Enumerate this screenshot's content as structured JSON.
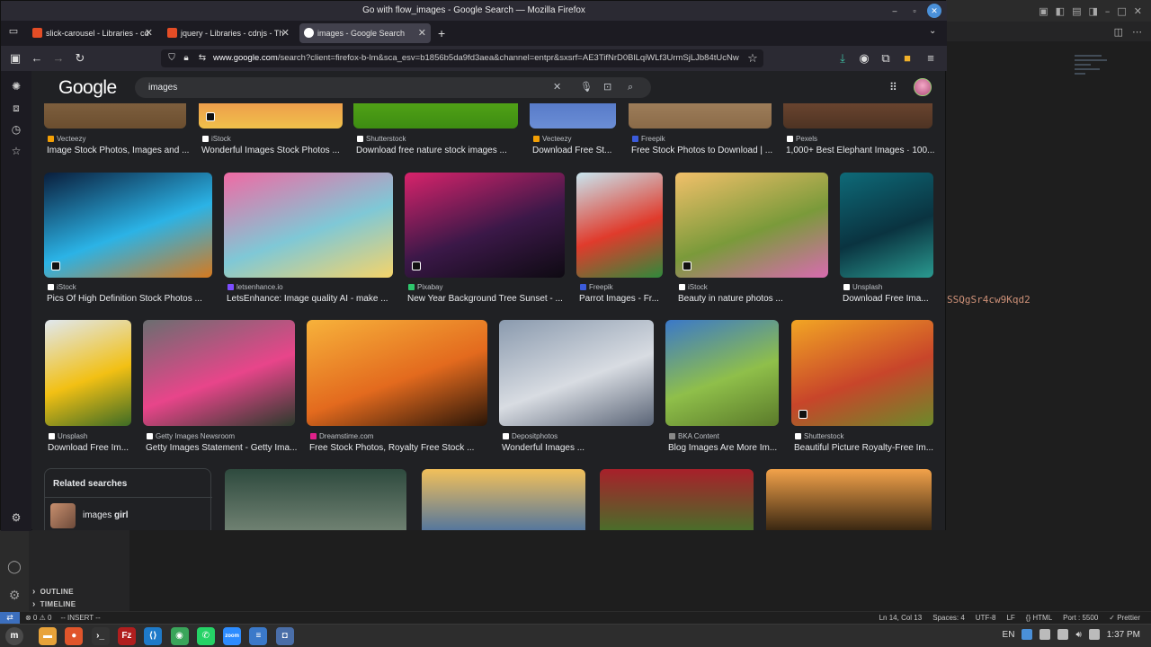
{
  "firefox": {
    "window_title": "Go with flow_images - Google Search — Mozilla Firefox",
    "tabs": [
      {
        "label": "slick-carousel - Libraries - cd",
        "fav_color": "#e44d26"
      },
      {
        "label": "jquery - Libraries - cdnjs - Th",
        "fav_color": "#e44d26"
      },
      {
        "label": "images - Google Search",
        "fav_color": "#ffffff"
      }
    ],
    "url_host": "www.google.com",
    "url_rest": "/search?client=firefox-b-lm&sca_esv=b1856b5da9fd3aea&channel=entpr&sxsrf=AE3TifNrD0BlLqiWLf3UrmSjLJb84tUcNw"
  },
  "google": {
    "logo": "Google",
    "query": "images",
    "results_row1": [
      {
        "source": "Vecteezy",
        "title": "Image Stock Photos, Images and ...",
        "fav": "#f29f05",
        "colors": [
          "#a88560",
          "#6b4e2f"
        ]
      },
      {
        "source": "iStock",
        "title": "Wonderful Images Stock Photos ...",
        "fav": "#ffffff",
        "colors": [
          "#e94b4b",
          "#f0c14b"
        ]
      },
      {
        "source": "Shutterstock",
        "title": "Download free nature stock images ...",
        "fav": "#ffffff",
        "colors": [
          "#7ed321",
          "#3d8c12"
        ]
      },
      {
        "source": "Vecteezy",
        "title": "Download Free St...",
        "fav": "#f29f05",
        "colors": [
          "#2b4ea8",
          "#6b8ed6"
        ]
      },
      {
        "source": "Freepik",
        "title": "Free Stock Photos to Download | ...",
        "fav": "#3b5bdb",
        "colors": [
          "#c9a982",
          "#8a6a48"
        ]
      },
      {
        "source": "Pexels",
        "title": "1,000+ Best Elephant Images · 100...",
        "fav": "#ffffff",
        "colors": [
          "#a86b4a",
          "#4e3323"
        ]
      }
    ],
    "results_row2": [
      {
        "source": "iStock",
        "title": "Pics Of High Definition Stock Photos ...",
        "fav": "#ffffff",
        "colors": [
          "#0a1e3c",
          "#2bb3e6",
          "#d67a1f"
        ]
      },
      {
        "source": "letsenhance.io",
        "title": "LetsEnhance: Image quality AI - make ...",
        "fav": "#7c4dff",
        "colors": [
          "#f06aa4",
          "#7fc8d6",
          "#f5d46a"
        ]
      },
      {
        "source": "Pixabay",
        "title": "New Year Background Tree Sunset - ...",
        "fav": "#2ec66d",
        "colors": [
          "#d8236b",
          "#3b1848",
          "#0e0a12"
        ]
      },
      {
        "source": "Freepik",
        "title": "Parrot Images - Fr...",
        "fav": "#3b5bdb",
        "colors": [
          "#c8e6f0",
          "#e03b2c",
          "#2f8a3b"
        ]
      },
      {
        "source": "iStock",
        "title": "Beauty in nature photos ...",
        "fav": "#ffffff",
        "colors": [
          "#f2c06a",
          "#7a9a3a",
          "#d86bb0"
        ]
      },
      {
        "source": "Unsplash",
        "title": "Download Free Ima...",
        "fav": "#ffffff",
        "colors": [
          "#0e6a78",
          "#0a3340",
          "#2a9a90"
        ]
      }
    ],
    "results_row3": [
      {
        "source": "Unsplash",
        "title": "Download Free Im...",
        "fav": "#ffffff",
        "colors": [
          "#e0e8f0",
          "#f2c014",
          "#3d6b25"
        ]
      },
      {
        "source": "Getty Images Newsroom",
        "title": "Getty Images Statement - Getty Ima...",
        "fav": "#ffffff",
        "colors": [
          "#6a6e70",
          "#e8458a",
          "#2b3a2c"
        ]
      },
      {
        "source": "Dreamstime.com",
        "title": "Free Stock Photos, Royalty Free Stock ...",
        "fav": "#e0218a",
        "colors": [
          "#f7b23b",
          "#e36a1e",
          "#2a1608"
        ]
      },
      {
        "source": "Depositphotos",
        "title": "Wonderful Images ...",
        "fav": "#ffffff",
        "colors": [
          "#8a9aae",
          "#d8dce2",
          "#5a6476"
        ]
      },
      {
        "source": "BKA Content",
        "title": "Blog Images Are More Im...",
        "fav": "#888888",
        "colors": [
          "#3a78c9",
          "#8fbf4a",
          "#5a7a2a"
        ]
      },
      {
        "source": "Shutterstock",
        "title": "Beautiful Picture Royalty-Free Im...",
        "fav": "#ffffff",
        "colors": [
          "#f2a524",
          "#c8452a",
          "#6b8a2a"
        ]
      }
    ],
    "results_row4_colors": [
      [
        "#2e4a3e",
        "#7a8a7a"
      ],
      [
        "#f2c05a",
        "#3a6aa8"
      ],
      [
        "#a8202a",
        "#3a7a2a"
      ],
      [
        "#f2a24a",
        "#1a1208"
      ]
    ],
    "related": {
      "heading": "Related searches",
      "item_prefix": "images",
      "item_bold": "girl"
    }
  },
  "vscode": {
    "code_fragment": "SSQgSr4cw9Kqd2",
    "outline": "OUTLINE",
    "timeline": "TIMELINE",
    "status_left": [
      "⊗ 0 ⚠ 0",
      "-- INSERT --"
    ],
    "status_right": [
      "Ln 14, Col 13",
      "Spaces: 4",
      "UTF-8",
      "LF",
      "{} HTML",
      "Port : 5500",
      "✓ Prettier"
    ]
  },
  "taskbar": {
    "apps": [
      {
        "name": "files",
        "color": "#e8a33a",
        "glyph": "▬"
      },
      {
        "name": "firefox",
        "color": "#e0552b",
        "glyph": "●"
      },
      {
        "name": "terminal",
        "color": "#333333",
        "glyph": "›_"
      },
      {
        "name": "filezilla",
        "color": "#b01e1e",
        "glyph": "Fz"
      },
      {
        "name": "vscode",
        "color": "#1e7ac9",
        "glyph": "⟨⟩"
      },
      {
        "name": "chrome",
        "color": "#3aa55a",
        "glyph": "◉"
      },
      {
        "name": "whatsapp",
        "color": "#25d366",
        "glyph": "✆"
      },
      {
        "name": "zoom",
        "color": "#2d8cff",
        "glyph": "zoom"
      },
      {
        "name": "notes",
        "color": "#3b79c9",
        "glyph": "≡"
      },
      {
        "name": "screenshot",
        "color": "#4a6ea8",
        "glyph": "◘"
      }
    ],
    "lang": "EN",
    "clock": "1:37 PM"
  }
}
